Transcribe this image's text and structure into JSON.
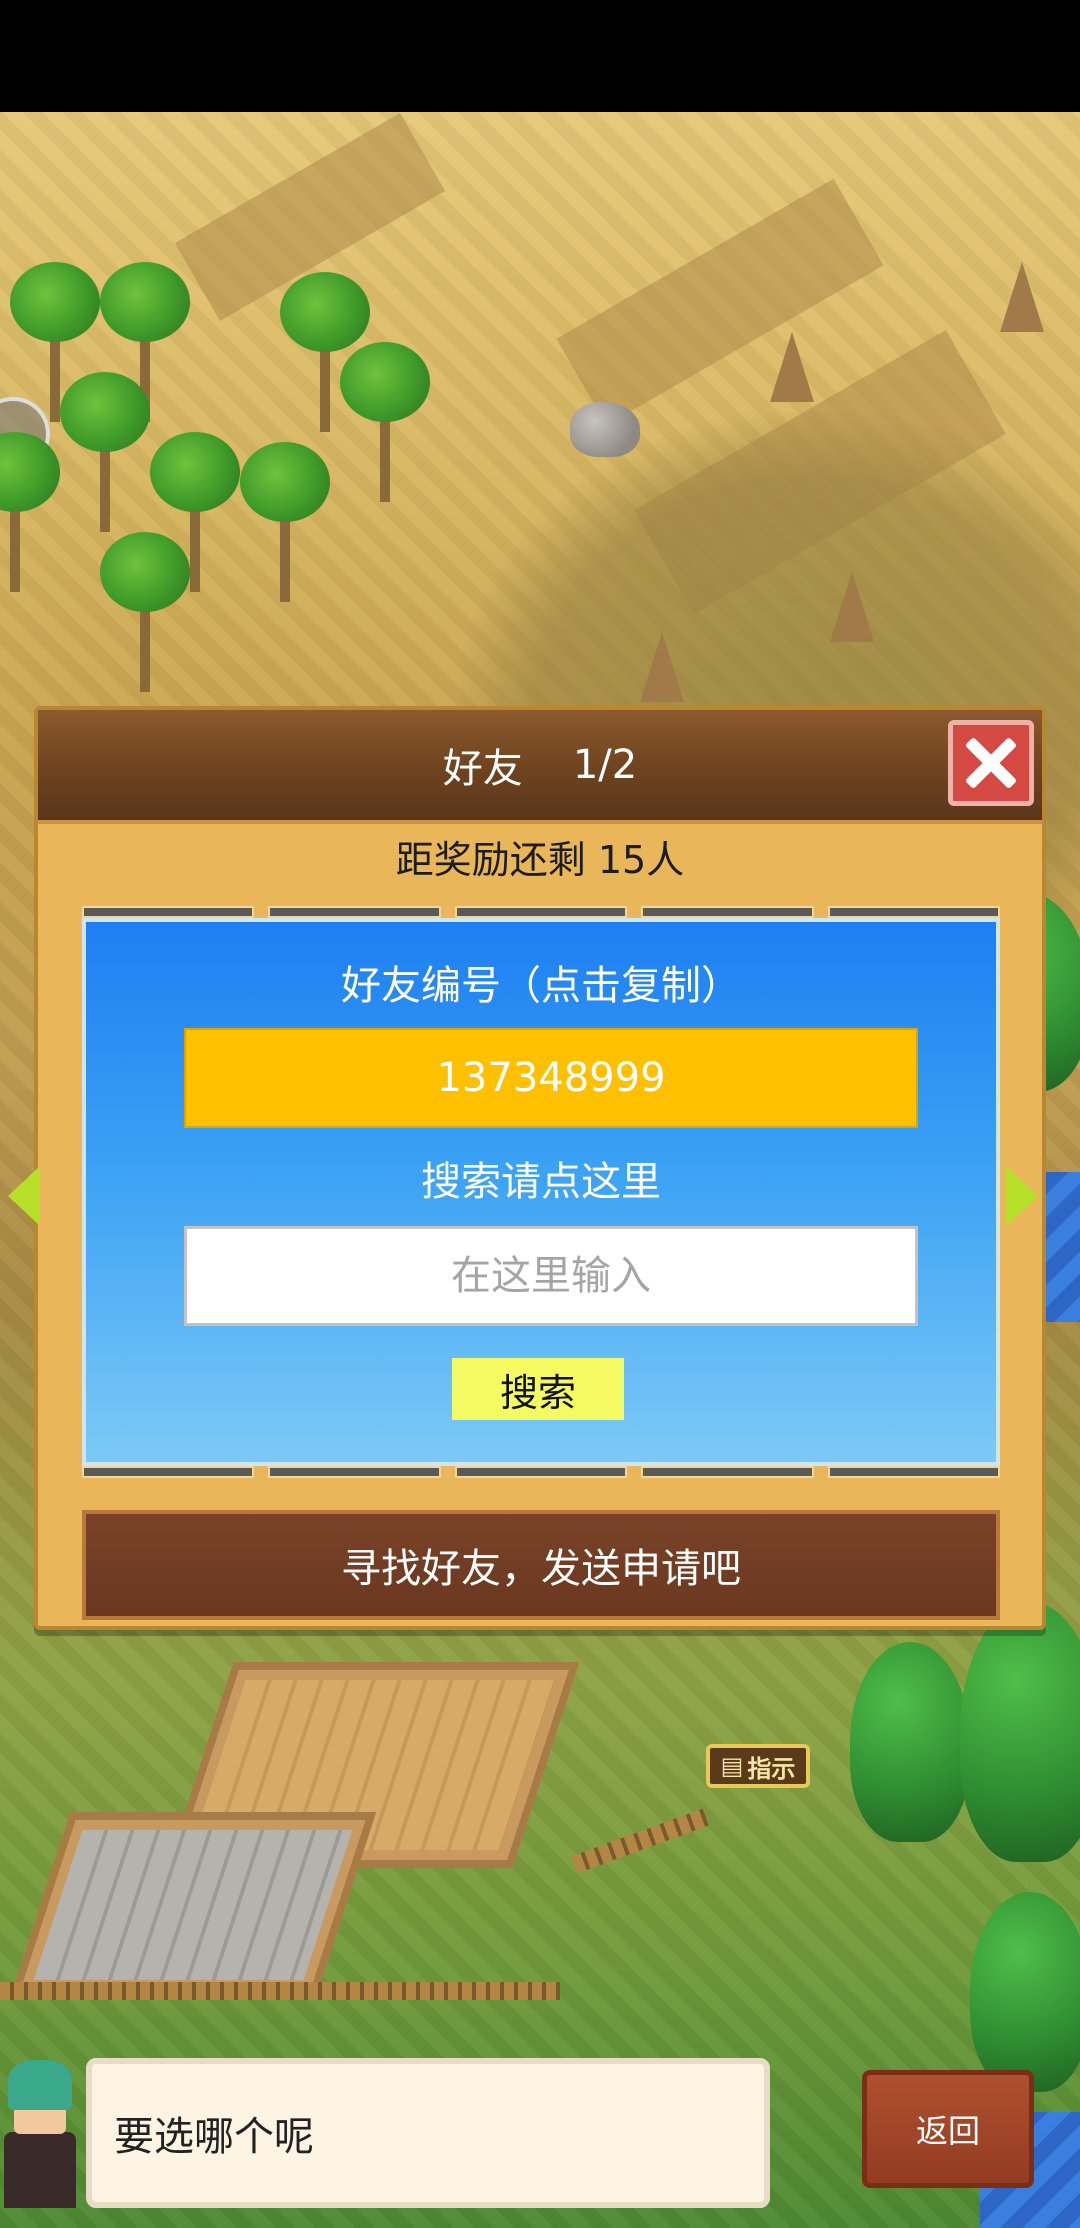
{
  "dialog": {
    "title": "好友",
    "page_indicator": "1/2",
    "reward_remaining": "距奖励还剩 15人",
    "friend_code_label": "好友编号（点击复制）",
    "friend_code": "137348999",
    "search_label": "搜索请点这里",
    "search_placeholder": "在这里输入",
    "search_button": "搜索",
    "find_friends_button": "寻找好友，发送申请吧"
  },
  "scene": {
    "sign_text": "指示"
  },
  "bottom": {
    "speech": "要选哪个呢",
    "back_button": "返回"
  },
  "colors": {
    "dialog_bg": "#e9b65a",
    "header_brown": "#6e4320",
    "panel_blue": "#1e7ff2",
    "code_yellow": "#ffc000",
    "search_button_bg": "#f3fa62",
    "close_red": "#d44a43",
    "arrow_green": "#b6e02a",
    "find_button_brown": "#6a3720",
    "back_button_red": "#923c22"
  },
  "icons": {
    "close": "close-icon",
    "prev": "chevron-left-icon",
    "next": "chevron-right-icon"
  }
}
